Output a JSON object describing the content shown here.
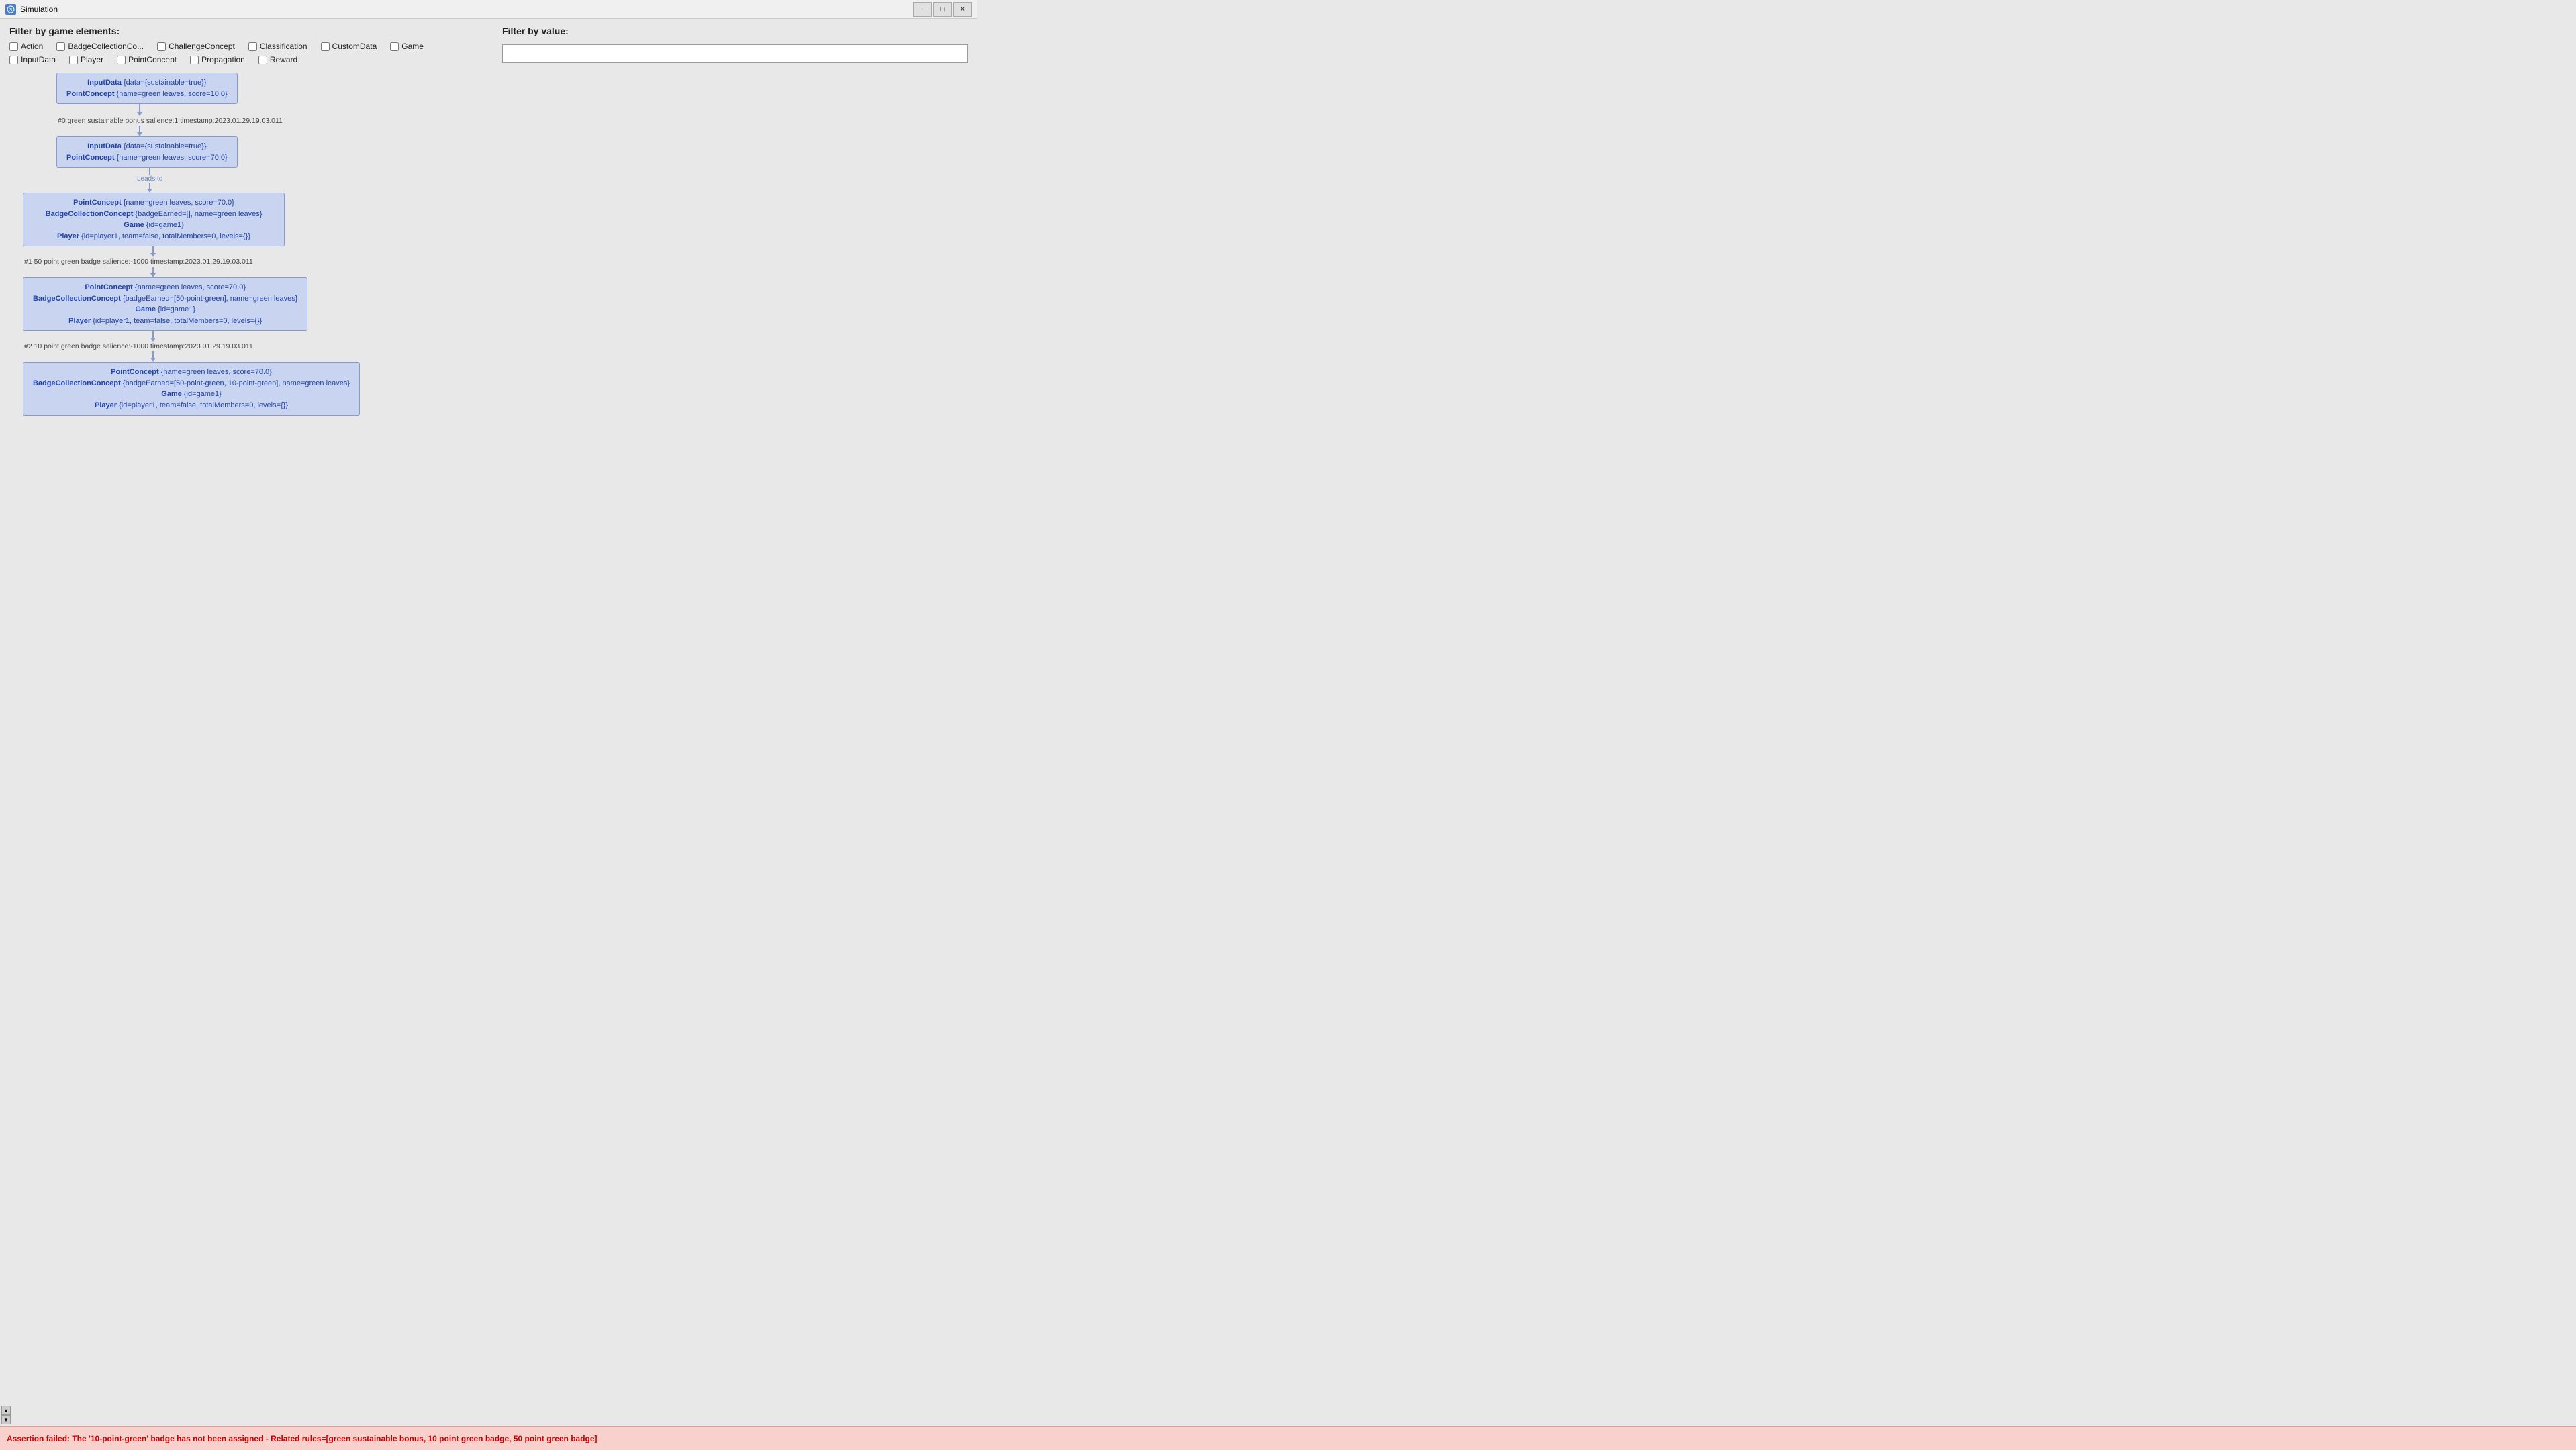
{
  "titleBar": {
    "icon": "S",
    "title": "Simulation",
    "minimizeLabel": "−",
    "maximizeLabel": "□",
    "closeLabel": "×"
  },
  "filterLeft": {
    "title": "Filter by game elements:",
    "checkboxes": [
      {
        "id": "cb-action",
        "label": "Action",
        "checked": false
      },
      {
        "id": "cb-badge",
        "label": "BadgeCollectionCo...",
        "checked": false
      },
      {
        "id": "cb-challenge",
        "label": "ChallengeConcept",
        "checked": false
      },
      {
        "id": "cb-classification",
        "label": "Classification",
        "checked": false
      },
      {
        "id": "cb-customdata",
        "label": "CustomData",
        "checked": false
      },
      {
        "id": "cb-game",
        "label": "Game",
        "checked": false
      },
      {
        "id": "cb-inputdata",
        "label": "InputData",
        "checked": false
      },
      {
        "id": "cb-player",
        "label": "Player",
        "checked": false
      },
      {
        "id": "cb-pointconcept",
        "label": "PointConcept",
        "checked": false
      },
      {
        "id": "cb-propagation",
        "label": "Propagation",
        "checked": false
      },
      {
        "id": "cb-reward",
        "label": "Reward",
        "checked": false
      }
    ]
  },
  "filterRight": {
    "title": "Filter by value:",
    "inputPlaceholder": ""
  },
  "nodes": [
    {
      "id": "node0",
      "lines": [
        {
          "type": "InputData",
          "params": "{data={sustainable=true}}"
        },
        {
          "type": "PointConcept",
          "params": "{name=green leaves, score=10.0}"
        }
      ]
    },
    {
      "id": "step0",
      "label": "#0 green sustainable bonus salience:1 timestamp:2023.01.29.19.03.011"
    },
    {
      "id": "node1",
      "lines": [
        {
          "type": "InputData",
          "params": "{data={sustainable=true}}"
        },
        {
          "type": "PointConcept",
          "params": "{name=green leaves, score=70.0}"
        }
      ]
    },
    {
      "id": "leads-to",
      "label": "Leads to"
    },
    {
      "id": "node2",
      "lines": [
        {
          "type": "PointConcept",
          "params": "{name=green leaves, score=70.0}"
        },
        {
          "type": "BadgeCollectionConcept",
          "params": " {badgeEarned=[], name=green leaves}"
        },
        {
          "type": "Game",
          "params": "{id=game1}"
        },
        {
          "type": "Player",
          "params": "{id=player1, team=false, totalMembers=0, levels={}}"
        }
      ]
    },
    {
      "id": "step1",
      "label": "#1 50 point green badge salience:-1000 timestamp:2023.01.29.19.03.011"
    },
    {
      "id": "node3",
      "lines": [
        {
          "type": "PointConcept",
          "params": "{name=green leaves, score=70.0}"
        },
        {
          "type": "BadgeCollectionConcept",
          "params": " {badgeEarned=[50-point-green], name=green leaves}"
        },
        {
          "type": "Game",
          "params": "{id=game1}"
        },
        {
          "type": "Player",
          "params": "{id=player1, team=false, totalMembers=0, levels={}}"
        }
      ]
    },
    {
      "id": "step2",
      "label": "#2 10 point green badge salience:-1000 timestamp:2023.01.29.19.03.011"
    },
    {
      "id": "node4",
      "lines": [
        {
          "type": "PointConcept",
          "params": "{name=green leaves, score=70.0}"
        },
        {
          "type": "BadgeCollectionConcept",
          "params": " {badgeEarned=[50-point-green, 10-point-green], name=green leaves}"
        },
        {
          "type": "Game",
          "params": "{id=game1}"
        },
        {
          "type": "Player",
          "params": "{id=player1, team=false, totalMembers=0, levels={}}"
        }
      ]
    }
  ],
  "errorBar": {
    "message": "Assertion failed: The '10-point-green' badge has not been assigned - Related rules=[green sustainable bonus, 10 point green badge, 50 point green badge]"
  },
  "scrollArrows": {
    "upLabel": "▲",
    "downLabel": "▼"
  }
}
